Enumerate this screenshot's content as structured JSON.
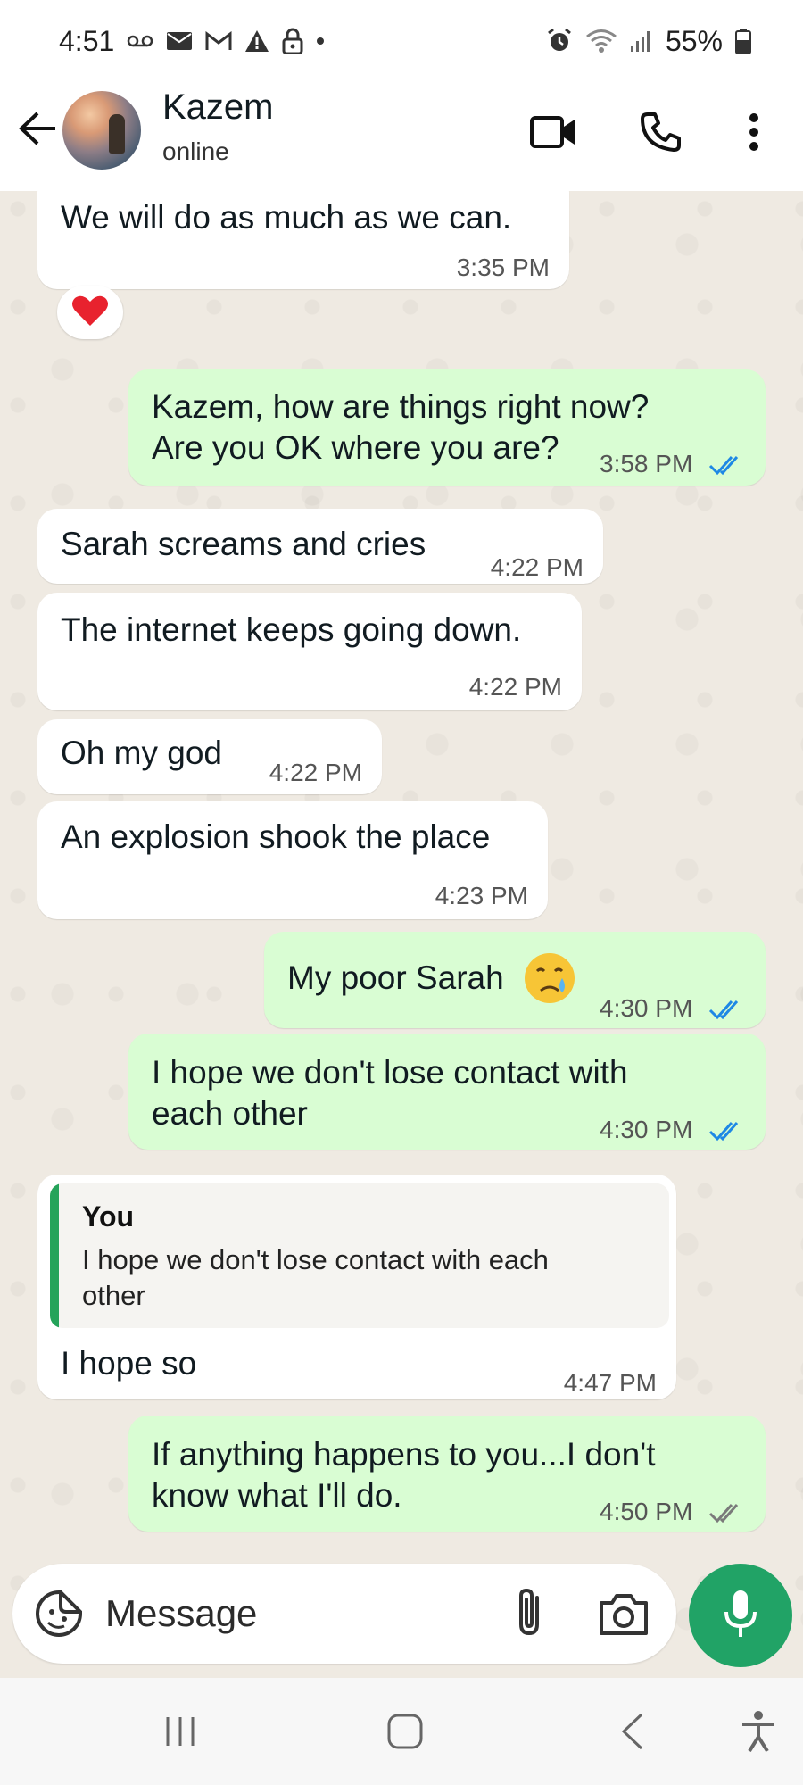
{
  "status_bar": {
    "time": "4:51",
    "battery": "55%"
  },
  "header": {
    "contact_name": "Kazem",
    "contact_status": "online"
  },
  "messages": [
    {
      "direction": "in",
      "text": "We will do as much as we can.",
      "time": "3:35 PM",
      "reaction": "red-heart"
    },
    {
      "direction": "out",
      "lines": [
        "Kazem, how are things right now?",
        "Are you OK where you are?"
      ],
      "time": "3:58 PM",
      "status": "read"
    },
    {
      "direction": "in",
      "text": "Sarah screams and cries",
      "time": "4:22 PM"
    },
    {
      "direction": "in",
      "text": "The internet keeps going down.",
      "time": "4:22 PM"
    },
    {
      "direction": "in",
      "text": "Oh my god",
      "time": "4:22 PM"
    },
    {
      "direction": "in",
      "text": "An explosion shook the place",
      "time": "4:23 PM"
    },
    {
      "direction": "out",
      "text": "My poor Sarah",
      "emoji": "crying-face",
      "time": "4:30 PM",
      "status": "read"
    },
    {
      "direction": "out",
      "lines": [
        "I hope we don't lose contact with",
        "each other"
      ],
      "time": "4:30 PM",
      "status": "read"
    },
    {
      "direction": "in",
      "quote_author": "You",
      "quote_lines": [
        "I hope we don't lose contact with each",
        "other"
      ],
      "text": "I hope so",
      "time": "4:47 PM"
    },
    {
      "direction": "out",
      "lines": [
        "If anything happens to you...I don't",
        "know what I'll do."
      ],
      "time": "4:50 PM",
      "status": "delivered"
    }
  ],
  "composer": {
    "placeholder": "Message"
  },
  "colors": {
    "incoming_bubble": "#ffffff",
    "outgoing_bubble": "#d9fdd3",
    "read_ticks": "#1e88e5",
    "delivered_ticks": "#7a7a7a",
    "accent": "#21a366"
  }
}
